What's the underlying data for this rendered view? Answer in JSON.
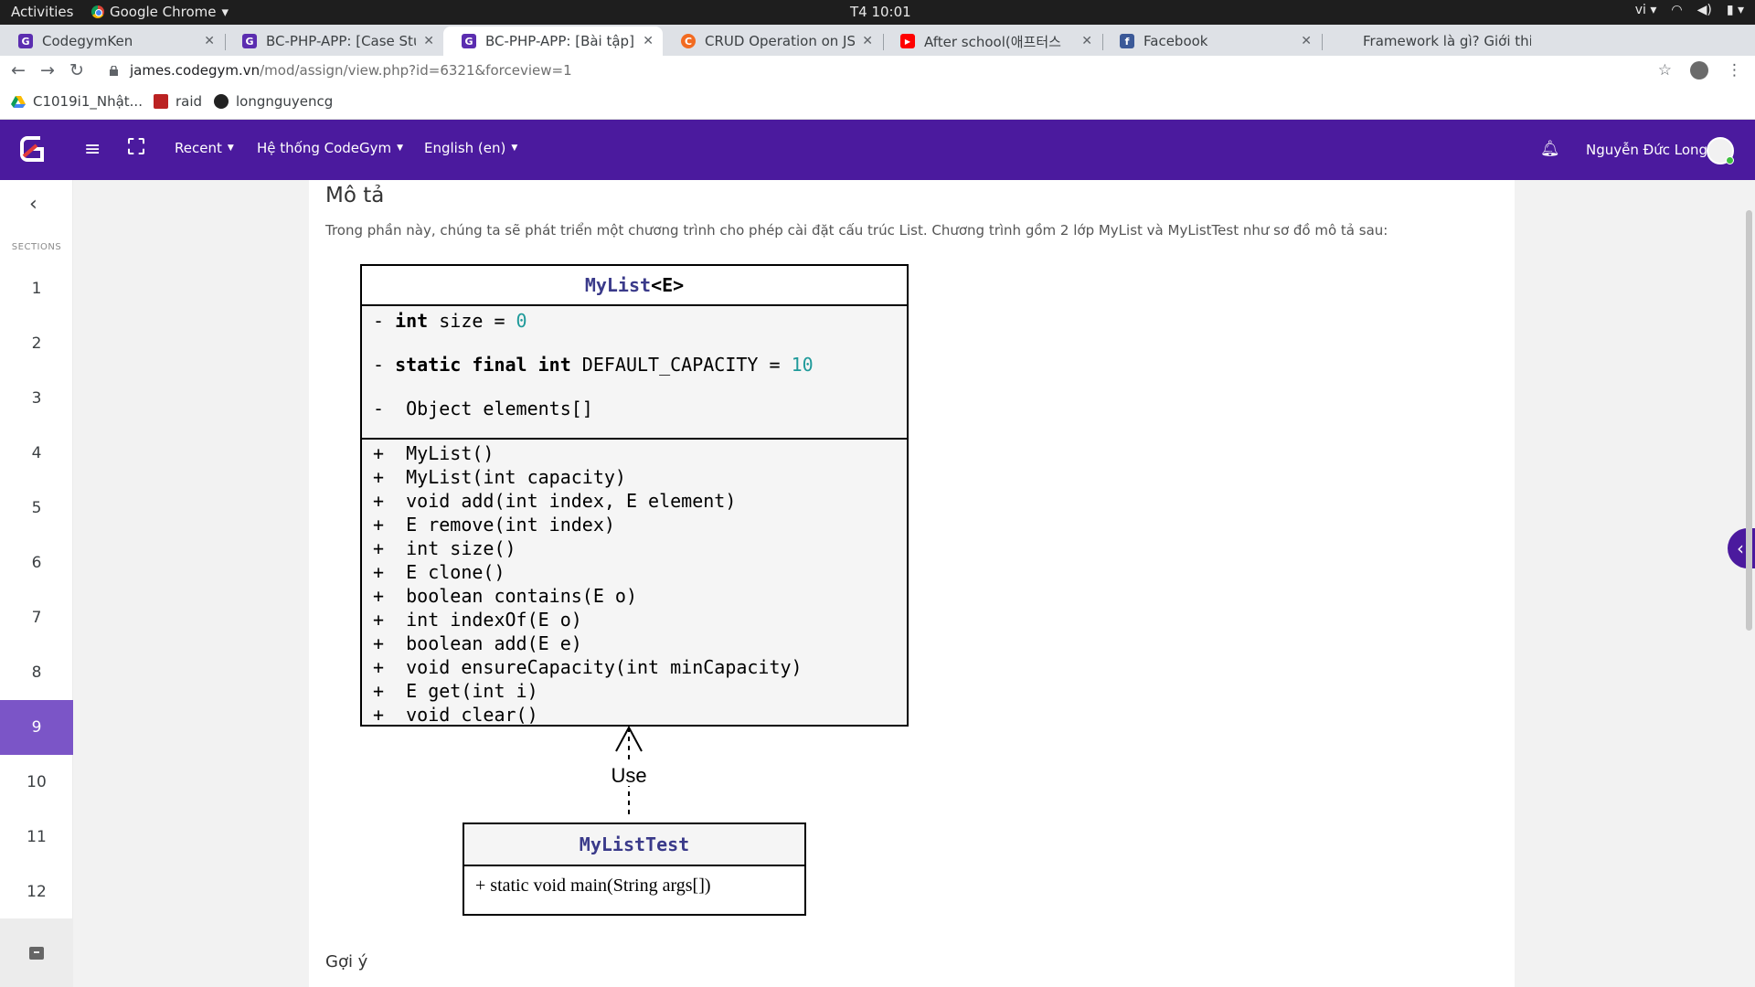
{
  "os_bar": {
    "activities": "Activities",
    "app_name": "Google Chrome",
    "clock": "T4 10:01",
    "lang": "vi"
  },
  "tabs": [
    {
      "title": "CodegymKen",
      "fav_color": "#5b2db0",
      "fav_glyph": "G"
    },
    {
      "title": "BC-PHP-APP: [Case Study]",
      "fav_color": "#5b2db0",
      "fav_glyph": "G"
    },
    {
      "title": "BC-PHP-APP: [Bài tập] Tri",
      "fav_color": "#5b2db0",
      "fav_glyph": "G"
    },
    {
      "title": "CRUD Operation on JSON",
      "fav_color": "#f26b21",
      "fav_glyph": "C"
    },
    {
      "title": "After school(애프터스",
      "fav_color": "#ff0000",
      "fav_glyph": "▶"
    },
    {
      "title": "Facebook",
      "fav_color": "#3b5998",
      "fav_glyph": "f"
    },
    {
      "title": "Framework là gì? Giới thiệ",
      "fav_color": "#ffffff",
      "fav_glyph": ""
    }
  ],
  "address": {
    "domain": "james.codegym.vn",
    "path": "/mod/assign/view.php?id=6321&forceview=1"
  },
  "bookmarks": [
    {
      "label": "C1019i1_Nhật...",
      "icon": "drive-icon"
    },
    {
      "label": "raid",
      "icon": "raid-icon"
    },
    {
      "label": "longnguyencg",
      "icon": "github-icon"
    }
  ],
  "navbar": {
    "menus": [
      {
        "label": "Recent"
      },
      {
        "label": "Hệ thống CodeGym"
      },
      {
        "label": "English (en)"
      }
    ],
    "user_name": "Nguyễn Đức Long",
    "brand_color": "#4b1a9e"
  },
  "sections": {
    "label": "SECTIONS",
    "items": [
      "1",
      "2",
      "3",
      "4",
      "5",
      "6",
      "7",
      "8",
      "9",
      "10",
      "11",
      "12"
    ],
    "active": "9"
  },
  "content": {
    "heading": "Mô tả",
    "description": "Trong phần này, chúng ta sẽ phát triển một chương trình cho phép cài đặt cấu trúc List. Chương trình gồm 2 lớp MyList và MyListTest như sơ đồ mô tả sau:",
    "hint_heading": "Gợi ý"
  },
  "uml": {
    "mylist": {
      "name": "MyList",
      "generic": "<E>",
      "fields": [
        {
          "prefix": "- ",
          "kw": "int",
          "rest": " size = ",
          "num": "0"
        },
        {
          "prefix": "- ",
          "kw": "static final int",
          "rest": " DEFAULT_CAPACITY = ",
          "num": "10"
        },
        {
          "prefix": "- ",
          "kw": "",
          "rest": " Object elements[]",
          "num": ""
        }
      ],
      "methods": [
        "+  MyList()",
        "+  MyList(int capacity)",
        "+  void add(int index, E element)",
        "+  E remove(int index)",
        "+  int size()",
        "+  E clone()",
        "+  boolean contains(E o)",
        "+  int indexOf(E o)",
        "+  boolean add(E e)",
        "+  void ensureCapacity(int minCapacity)",
        "+  E get(int i)",
        "+  void clear()"
      ]
    },
    "relation_label": "Use",
    "mylisttest": {
      "name": "MyListTest",
      "methods": [
        "+ static void main(String args[])"
      ]
    }
  }
}
